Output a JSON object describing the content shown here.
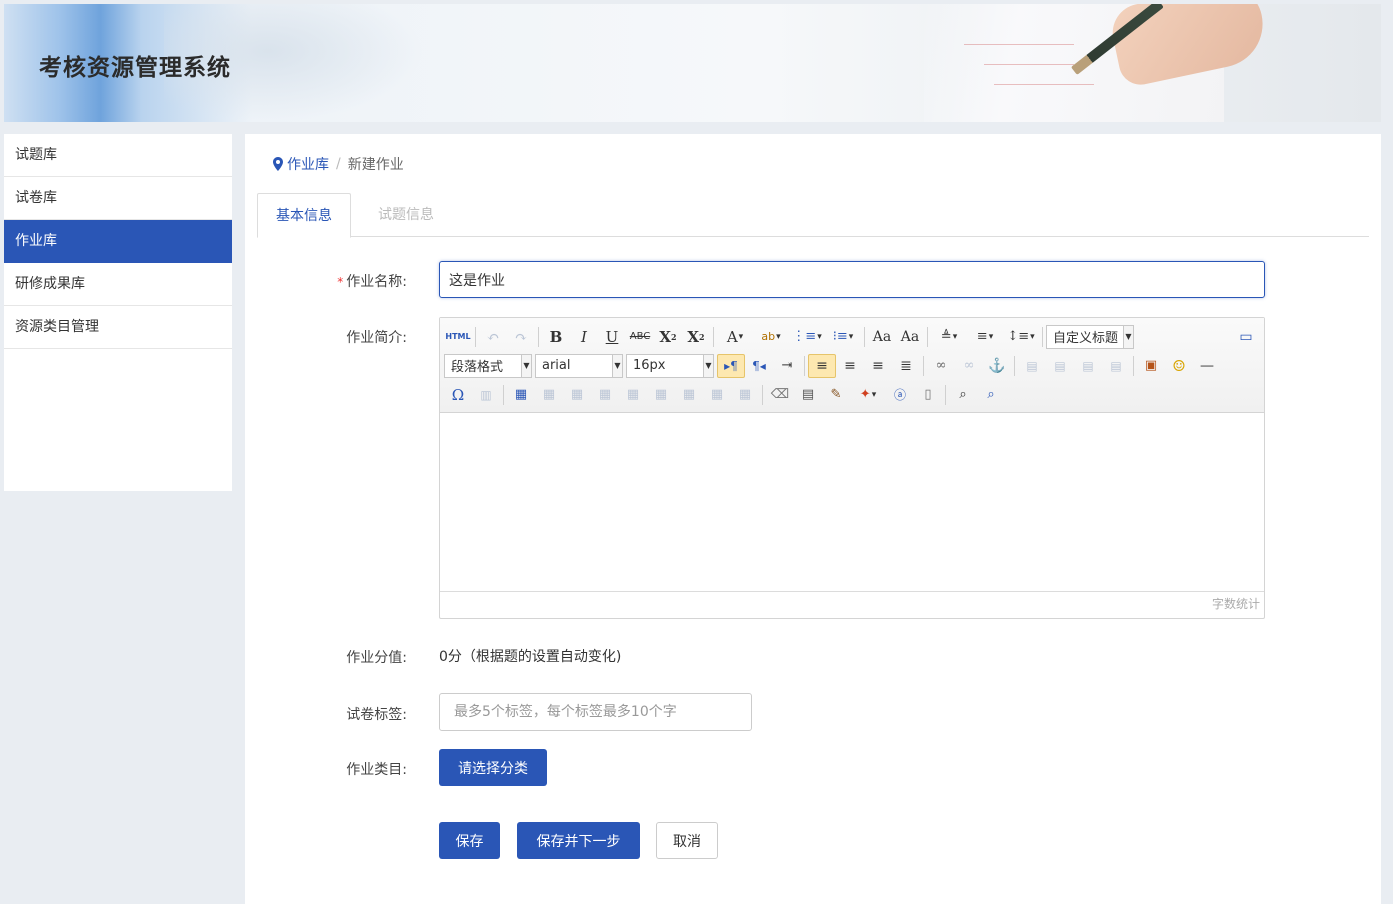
{
  "header": {
    "title": "考核资源管理系统"
  },
  "sidebar": {
    "items": [
      {
        "label": "试题库"
      },
      {
        "label": "试卷库"
      },
      {
        "label": "作业库"
      },
      {
        "label": "研修成果库"
      },
      {
        "label": "资源类目管理"
      }
    ]
  },
  "breadcrumb": {
    "parent": "作业库",
    "current": "新建作业"
  },
  "tabs": [
    {
      "label": "基本信息"
    },
    {
      "label": "试题信息"
    }
  ],
  "form": {
    "name_label": "作业名称:",
    "name_value": "这是作业",
    "intro_label": "作业简介:",
    "score_label": "作业分值:",
    "score_value": "0分（根据题的设置自动变化)",
    "tags_label": "试卷标签:",
    "tags_placeholder": "最多5个标签，每个标签最多10个字",
    "category_label": "作业类目:",
    "category_button": "请选择分类"
  },
  "editor": {
    "paragraph_format": "段落格式",
    "font_family": "arial",
    "font_size": "16px",
    "custom_title": "自定义标题",
    "word_count": "字数统计",
    "html_label": "HTML"
  },
  "actions": {
    "save": "保存",
    "save_next": "保存并下一步",
    "cancel": "取消"
  },
  "colors": {
    "primary": "#2a56b6",
    "required": "#ee3333"
  }
}
